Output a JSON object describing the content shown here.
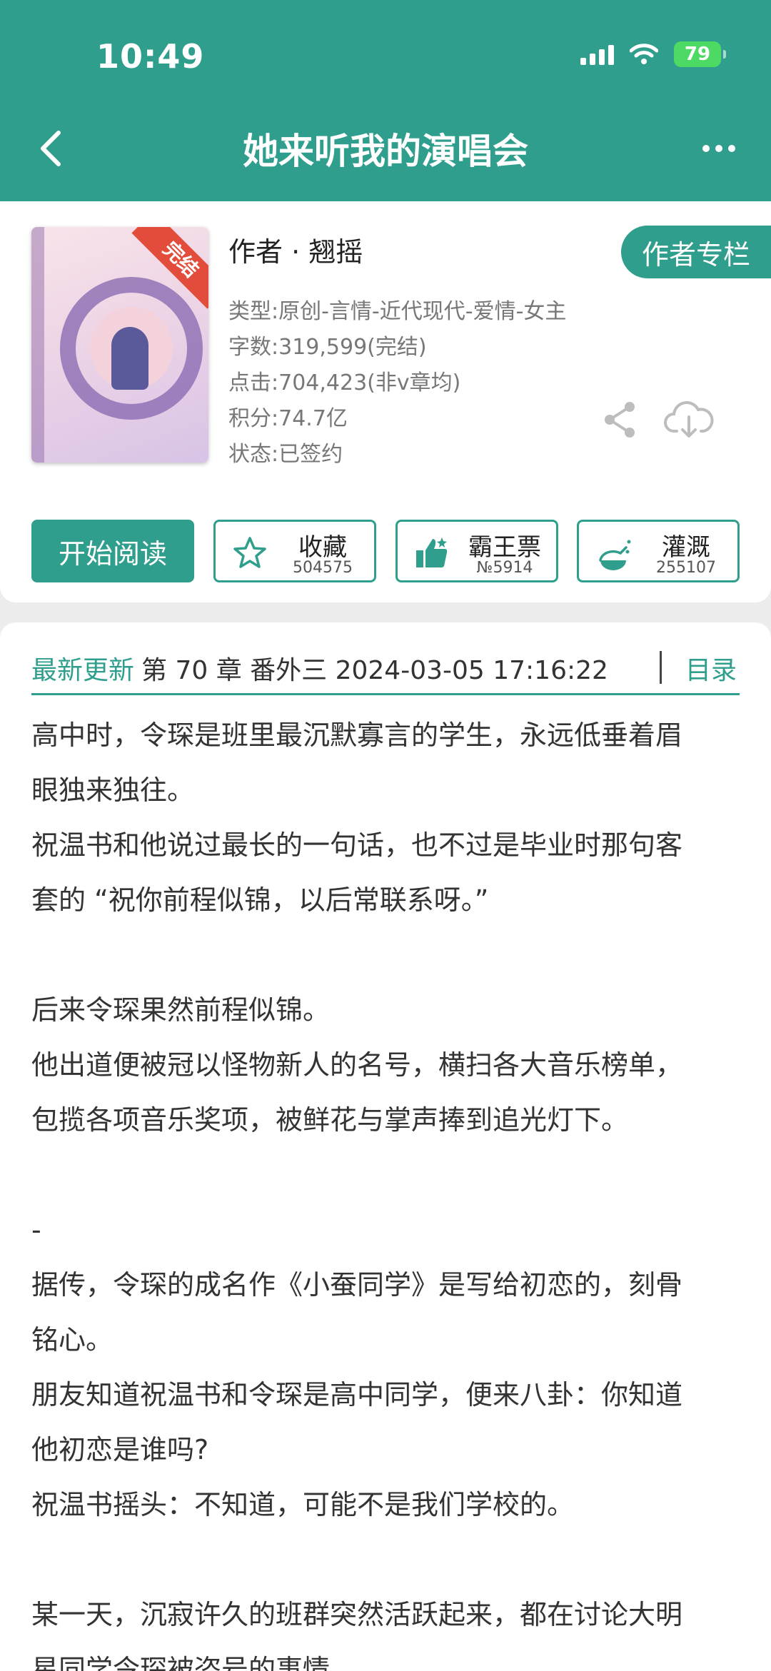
{
  "status_bar": {
    "time": "10:49",
    "battery": "79"
  },
  "nav": {
    "title": "她来听我的演唱会"
  },
  "book": {
    "cover_badge": "完结",
    "author": "作者 · 翘摇",
    "author_column_label": "作者专栏",
    "meta": [
      "类型:原创-言情-近代现代-爱情-女主",
      "字数:319,599(完结)",
      "点击:704,423(非v章均)",
      "积分:74.7亿",
      "状态:已签约"
    ]
  },
  "actions": {
    "read_label": "开始阅读",
    "favorite": {
      "label": "收藏",
      "count": "504575"
    },
    "vote": {
      "label": "霸王票",
      "count": "№5914"
    },
    "water": {
      "label": "灌溉",
      "count": "255107"
    }
  },
  "latest": {
    "label": "最新更新",
    "text": "第 70 章  番外三 2024-03-05 17:16:22",
    "toc_label": "目录"
  },
  "paragraphs": [
    "高中时，令琛是班里最沉默寡言的学生，永远低垂着眉",
    "眼独来独往。",
    "祝温书和他说过最长的一句话，也不过是毕业时那句客",
    "套的 “祝你前程似锦，以后常联系呀。”",
    "",
    "后来令琛果然前程似锦。",
    "他出道便被冠以怪物新人的名号，横扫各大音乐榜单，",
    "包揽各项音乐奖项，被鲜花与掌声捧到追光灯下。",
    "",
    "-",
    "据传，令琛的成名作《小蚕同学》是写给初恋的，刻骨",
    "铭心。",
    "朋友知道祝温书和令琛是高中同学，便来八卦：你知道",
    "他初恋是谁吗?",
    "祝温书摇头：不知道，可能不是我们学校的。",
    "",
    "某一天，沉寂许久的班群突然活跃起来，都在讨论大明",
    "星同学令琛被盗号的事情"
  ],
  "colors": {
    "accent": "#2f9e8c",
    "ribbon": "#e34b3a"
  }
}
